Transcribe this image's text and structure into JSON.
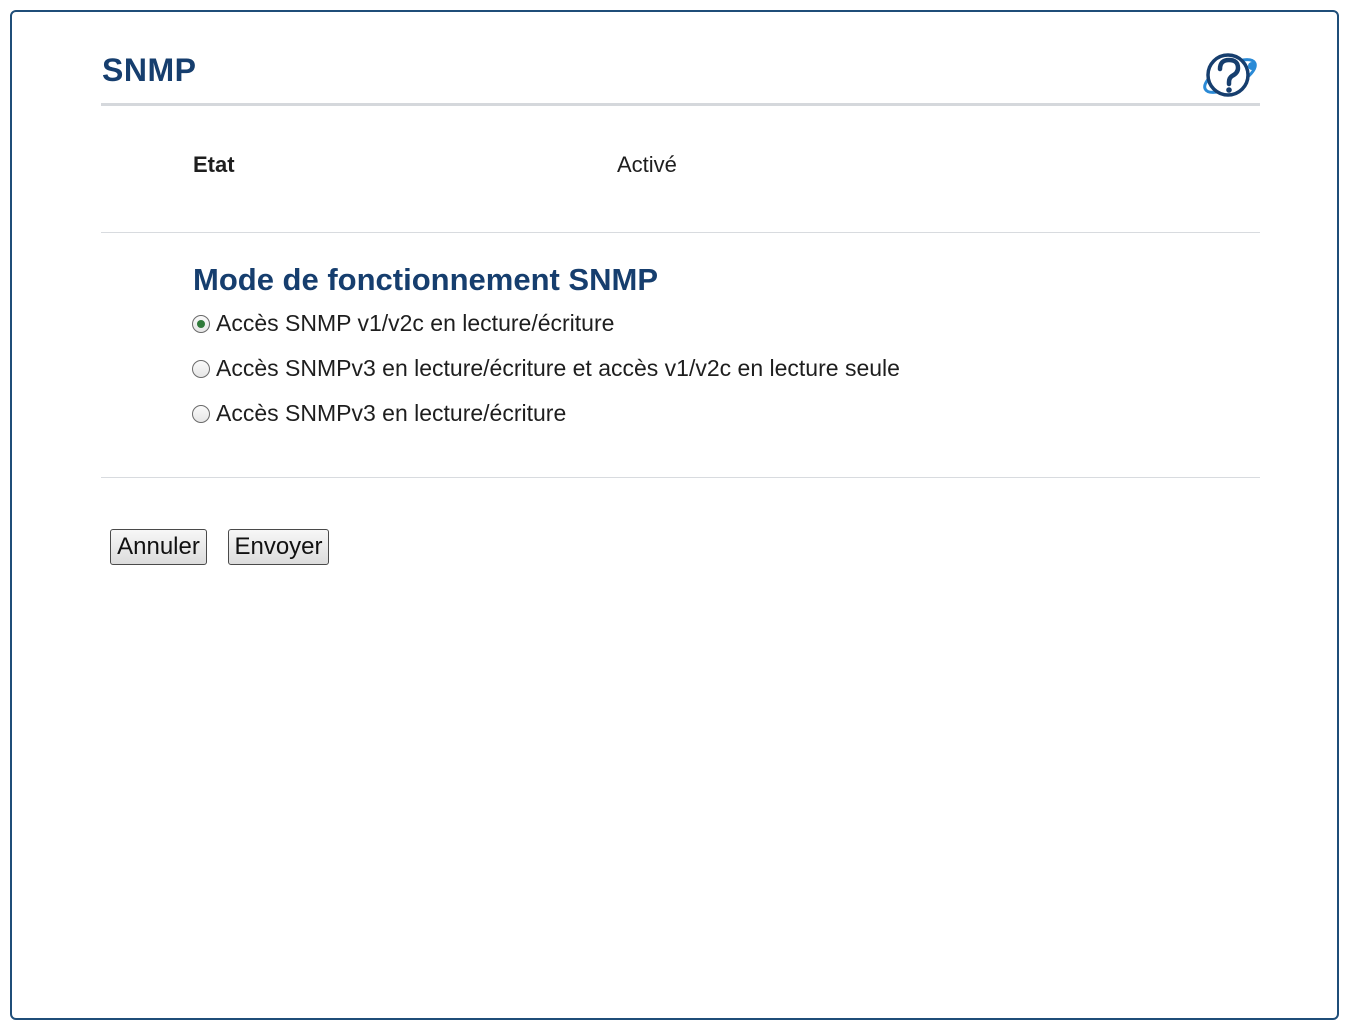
{
  "page": {
    "title": "SNMP"
  },
  "status": {
    "label": "Etat",
    "value": "Activé"
  },
  "mode": {
    "title": "Mode de fonctionnement SNMP",
    "options": [
      {
        "label": "Accès SNMP v1/v2c en lecture/écriture",
        "checked": true
      },
      {
        "label": "Accès SNMPv3 en lecture/écriture et accès v1/v2c en lecture seule",
        "checked": false
      },
      {
        "label": "Accès SNMPv3 en lecture/écriture",
        "checked": false
      }
    ]
  },
  "buttons": {
    "cancel": "Annuler",
    "submit": "Envoyer"
  },
  "icons": {
    "help": "help-icon"
  },
  "colors": {
    "heading": "#163e6e",
    "frame": "#1f4e79",
    "help_accent": "#2a8ad6"
  }
}
